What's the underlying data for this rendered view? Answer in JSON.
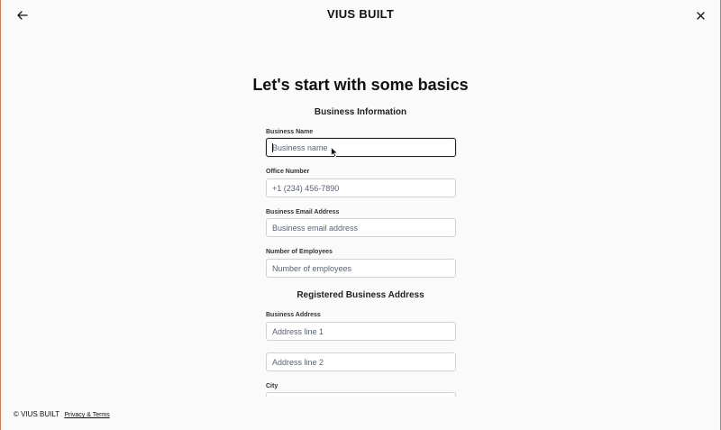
{
  "header": {
    "brand": "VIUS BUILT",
    "back_icon": "arrow-left-icon",
    "close_icon": "close-icon"
  },
  "main": {
    "heading": "Let's start with some basics",
    "business_info": {
      "title": "Business Information",
      "fields": [
        {
          "label": "Business Name",
          "placeholder": "Business name",
          "value": ""
        },
        {
          "label": "Office Number",
          "placeholder": "+1 (234) 456-7890",
          "value": ""
        },
        {
          "label": "Business Email Address",
          "placeholder": "Business email address",
          "value": ""
        },
        {
          "label": "Number of Employees",
          "placeholder": "Number of employees",
          "value": ""
        }
      ]
    },
    "address": {
      "title": "Registered Business Address",
      "label": "Business Address",
      "line1_placeholder": "Address line 1",
      "line2_placeholder": "Address line 2",
      "city_label": "City"
    }
  },
  "footer": {
    "copyright": "© VIUS BUILT",
    "privacy_link": "Privacy & Terms"
  },
  "colors": {
    "background": "#fafafa",
    "frame_border": "#c8795a",
    "input_border": "#cfd3d8",
    "focus_border": "#1f2329"
  }
}
